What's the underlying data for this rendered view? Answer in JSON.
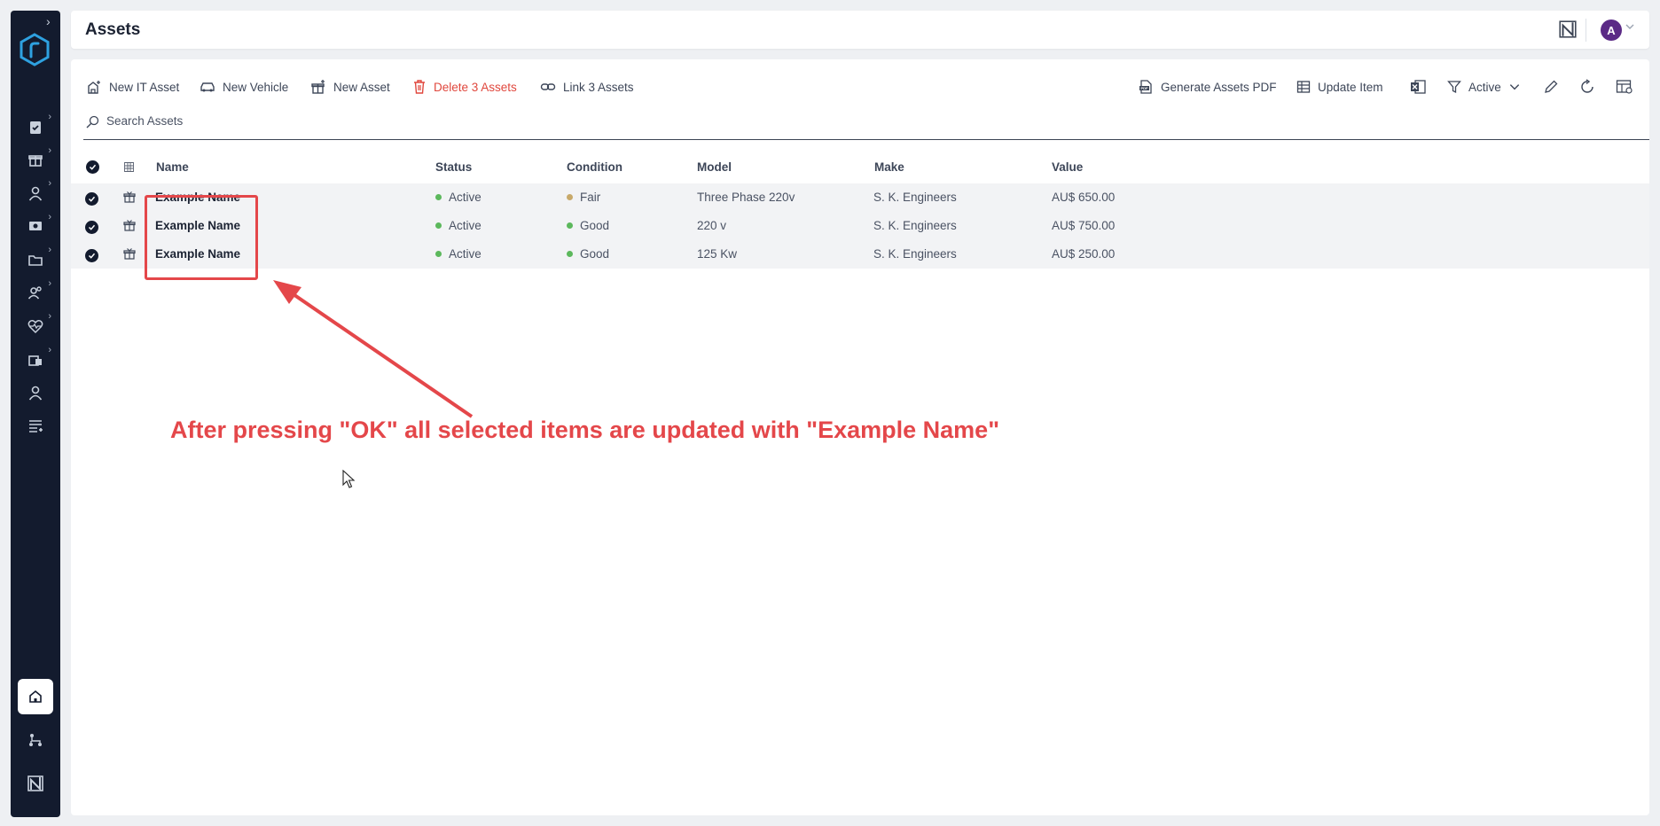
{
  "header": {
    "title": "Assets",
    "avatar_initial": "A"
  },
  "toolbar": {
    "new_it_asset": "New IT Asset",
    "new_vehicle": "New Vehicle",
    "new_asset": "New Asset",
    "delete_assets": "Delete 3 Assets",
    "link_assets": "Link 3 Assets",
    "generate_pdf": "Generate Assets PDF",
    "update_item": "Update Item",
    "filter_label": "Active"
  },
  "search": {
    "placeholder": "Search Assets"
  },
  "table": {
    "columns": {
      "name": "Name",
      "status": "Status",
      "condition": "Condition",
      "model": "Model",
      "make": "Make",
      "value": "Value"
    },
    "rows": [
      {
        "name": "Example Name",
        "status": "Active",
        "condition": "Fair",
        "model": "Three Phase 220v",
        "make": "S. K. Engineers",
        "value": "AU$ 650.00"
      },
      {
        "name": "Example Name",
        "status": "Active",
        "condition": "Good",
        "model": "220 v",
        "make": "S. K. Engineers",
        "value": "AU$ 750.00"
      },
      {
        "name": "Example Name",
        "status": "Active",
        "condition": "Good",
        "model": "125 Kw",
        "make": "S. K. Engineers",
        "value": "AU$ 250.00"
      }
    ]
  },
  "annotation": {
    "text": "After pressing \"OK\" all selected items are updated with \"Example Name\""
  },
  "colors": {
    "sidebar_bg": "#131b2e",
    "accent": "#2ea1e0",
    "danger": "#e0473d",
    "status_active": "#5cb85c",
    "condition_fair": "#c8a96a",
    "condition_good": "#5cb85c",
    "annotation": "#e4474a",
    "avatar": "#5b2a86"
  },
  "icons": {
    "sidebar": [
      "clipboard-check-icon",
      "gift-box-icon",
      "user-icon",
      "money-icon",
      "folder-icon",
      "users-icon",
      "heartbeat-icon",
      "building-icon",
      "profile-icon",
      "list-icon"
    ],
    "sidebar_bottom": [
      "home-icon",
      "hierarchy-icon",
      "brand-icon"
    ]
  }
}
